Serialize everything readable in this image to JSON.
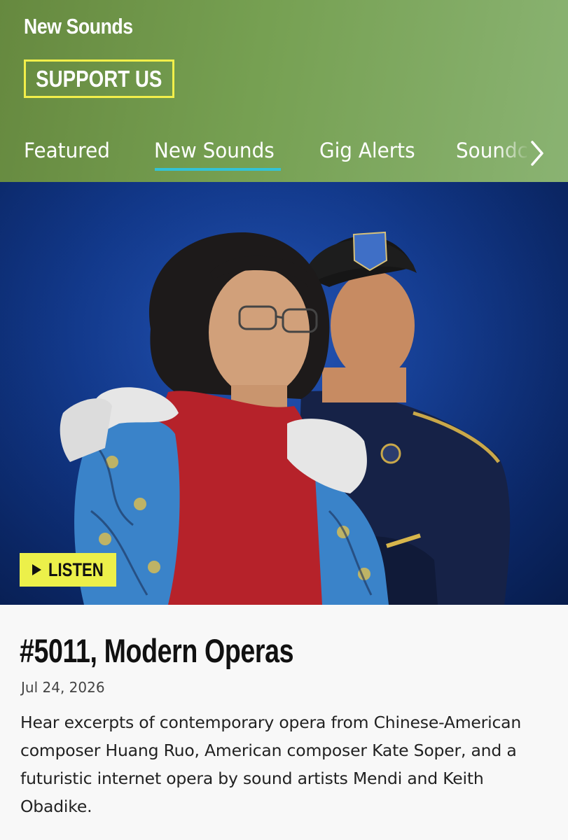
{
  "header": {
    "brand": "New Sounds",
    "support_label": "SUPPORT US",
    "tabs": [
      {
        "label": "Featured",
        "active": false
      },
      {
        "label": "New Sounds",
        "active": true
      },
      {
        "label": "Gig Alerts",
        "active": false
      },
      {
        "label": "Soundcheck",
        "active": false
      }
    ],
    "colors": {
      "accent_underline": "#33c3d6",
      "support_border": "#f2ef4a"
    }
  },
  "hero": {
    "listen_label": "LISTEN",
    "icon": "play-icon",
    "listen_bg": "#ecf04a"
  },
  "article": {
    "title": "#5011, Modern Operas",
    "date": "Jul 24, 2026",
    "description": "Hear excerpts of contemporary opera from Chinese-American composer Huang Ruo, American composer Kate Soper, and a futuristic internet opera by sound artists Mendi and Keith Obadike."
  }
}
